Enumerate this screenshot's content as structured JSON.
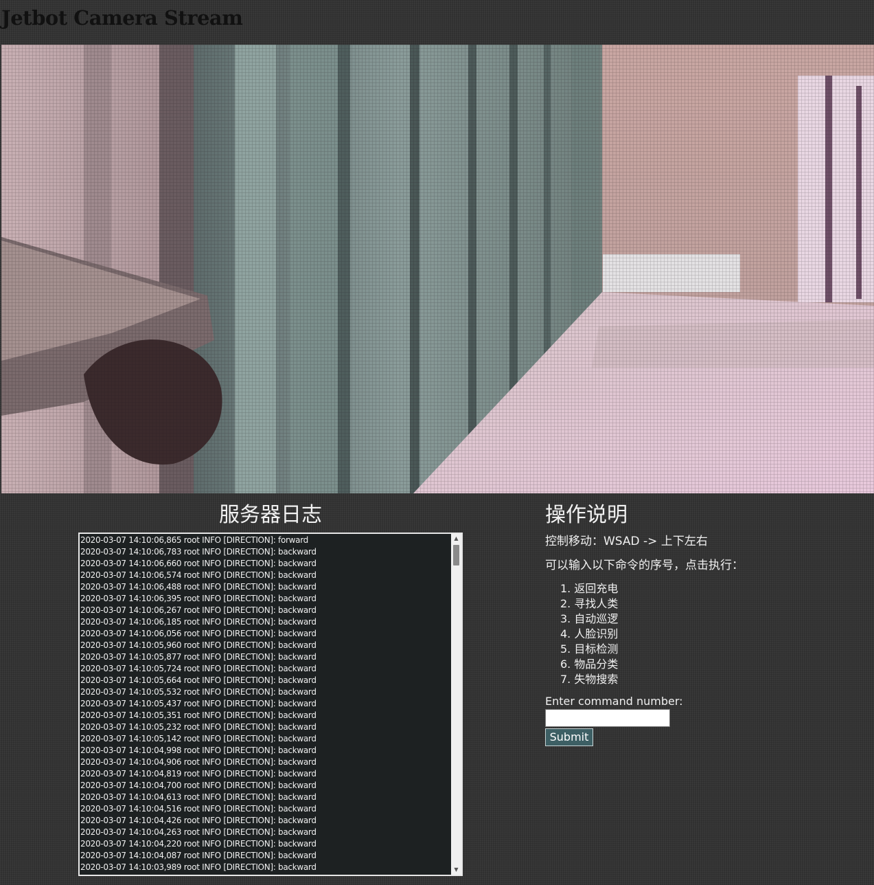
{
  "page": {
    "title": "Jetbot Camera Stream"
  },
  "camera": {
    "alt": "camera-stream"
  },
  "log": {
    "heading": "服务器日志",
    "lines": [
      "2020-03-07 14:10:06,865 root INFO [DIRECTION]: forward",
      "2020-03-07 14:10:06,783 root INFO [DIRECTION]: backward",
      "2020-03-07 14:10:06,660 root INFO [DIRECTION]: backward",
      "2020-03-07 14:10:06,574 root INFO [DIRECTION]: backward",
      "2020-03-07 14:10:06,488 root INFO [DIRECTION]: backward",
      "2020-03-07 14:10:06,395 root INFO [DIRECTION]: backward",
      "2020-03-07 14:10:06,267 root INFO [DIRECTION]: backward",
      "2020-03-07 14:10:06,185 root INFO [DIRECTION]: backward",
      "2020-03-07 14:10:06,056 root INFO [DIRECTION]: backward",
      "2020-03-07 14:10:05,960 root INFO [DIRECTION]: backward",
      "2020-03-07 14:10:05,877 root INFO [DIRECTION]: backward",
      "2020-03-07 14:10:05,724 root INFO [DIRECTION]: backward",
      "2020-03-07 14:10:05,664 root INFO [DIRECTION]: backward",
      "2020-03-07 14:10:05,532 root INFO [DIRECTION]: backward",
      "2020-03-07 14:10:05,437 root INFO [DIRECTION]: backward",
      "2020-03-07 14:10:05,351 root INFO [DIRECTION]: backward",
      "2020-03-07 14:10:05,232 root INFO [DIRECTION]: backward",
      "2020-03-07 14:10:05,142 root INFO [DIRECTION]: backward",
      "2020-03-07 14:10:04,998 root INFO [DIRECTION]: backward",
      "2020-03-07 14:10:04,906 root INFO [DIRECTION]: backward",
      "2020-03-07 14:10:04,819 root INFO [DIRECTION]: backward",
      "2020-03-07 14:10:04,700 root INFO [DIRECTION]: backward",
      "2020-03-07 14:10:04,613 root INFO [DIRECTION]: backward",
      "2020-03-07 14:10:04,516 root INFO [DIRECTION]: backward",
      "2020-03-07 14:10:04,426 root INFO [DIRECTION]: backward",
      "2020-03-07 14:10:04,263 root INFO [DIRECTION]: backward",
      "2020-03-07 14:10:04,220 root INFO [DIRECTION]: backward",
      "2020-03-07 14:10:04,087 root INFO [DIRECTION]: backward",
      "2020-03-07 14:10:03,989 root INFO [DIRECTION]: backward"
    ]
  },
  "help": {
    "heading": "操作说明",
    "move_text": "控制移动：WSAD -> 上下左右",
    "intro_text": "可以输入以下命令的序号，点击执行：",
    "commands": [
      "1. 返回充电",
      "2. 寻找人类",
      "3. 自动巡逻",
      "4. 人脸识别",
      "5. 目标检测",
      "6. 物品分类",
      "7. 失物搜索"
    ],
    "input_label": "Enter command number:",
    "input_value": "",
    "submit_label": "Submit"
  }
}
